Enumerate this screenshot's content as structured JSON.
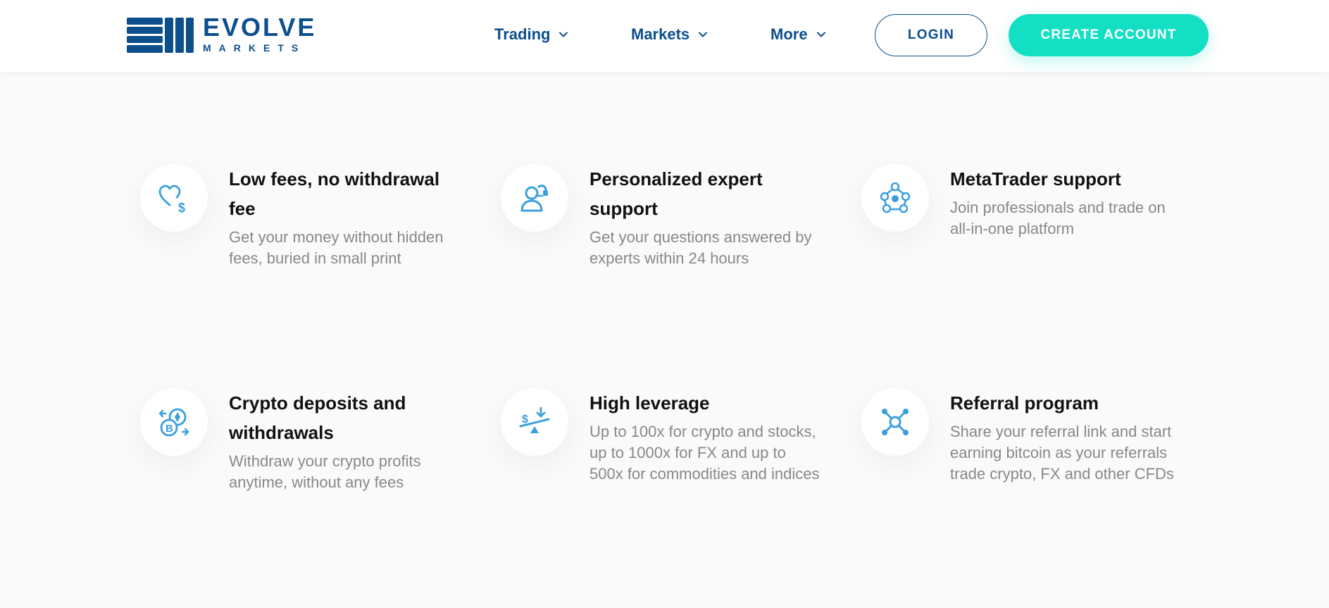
{
  "brand": {
    "name": "EVOLVE",
    "sub": "MARKETS",
    "color": "#0c4f8c"
  },
  "nav": {
    "items": [
      {
        "label": "Trading",
        "icon": "chevron-down-icon"
      },
      {
        "label": "Markets",
        "icon": "chevron-down-icon"
      },
      {
        "label": "More",
        "icon": "chevron-down-icon"
      }
    ],
    "login_label": "LOGIN",
    "create_label": "CREATE ACCOUNT"
  },
  "colors": {
    "accent": "#13dfc3",
    "icon": "#3a9fdc",
    "text_muted": "#888888"
  },
  "features": [
    {
      "icon": "heart-dollar-icon",
      "title": "Low fees, no withdrawal fee",
      "desc": "Get your money without hidden fees, buried in small print"
    },
    {
      "icon": "support-agent-icon",
      "title": "Personalized expert support",
      "desc": "Get your questions answered by experts within 24 hours"
    },
    {
      "icon": "metatrader-network-icon",
      "title": "MetaTrader support",
      "desc": "Join professionals and trade on all-in-one platform"
    },
    {
      "icon": "crypto-exchange-icon",
      "title": "Crypto deposits and withdrawals",
      "desc": "Withdraw your crypto profits anytime, without any fees"
    },
    {
      "icon": "leverage-scale-icon",
      "title": "High leverage",
      "desc": "Up to 100x for crypto and stocks, up to 1000x for FX and up to 500x for commodities and indices"
    },
    {
      "icon": "referral-network-icon",
      "title": "Referral program",
      "desc": "Share your referral link and start earning bitcoin as your referrals trade crypto, FX and other CFDs"
    }
  ]
}
